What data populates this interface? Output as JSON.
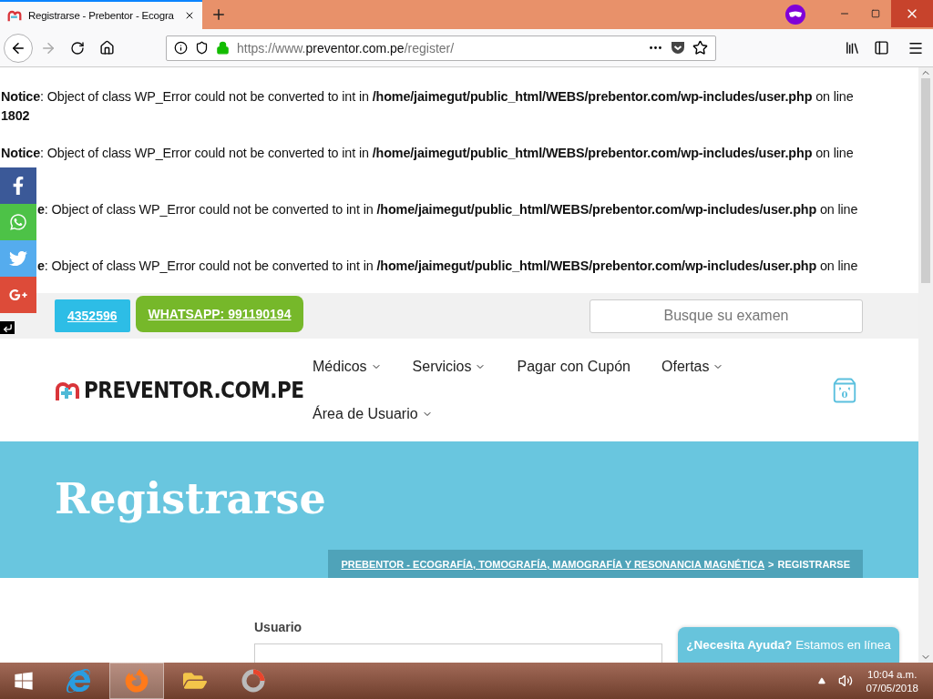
{
  "browser": {
    "tabs": [
      {
        "title": "Registrarse - Prebentor - Ecogra",
        "selected": true
      }
    ],
    "url": {
      "host": "https://www.preventor.com.pe",
      "path": "/register/"
    }
  },
  "notices": [
    {
      "text": "**Notice**: Object of class WP_Error could not be converted to int in **/home/jaimegut/public_html/WEBS/prebentor.com/wp-includes/user.php** on line",
      "line": "1802"
    },
    {
      "text": "**Notice**: Object of class WP_Error could not be converted to int in **/home/jaimegut/public_html/WEBS/prebentor.com/wp-includes/user.php** on line"
    },
    {
      "kind": "covered",
      "text": "**e**: Object of class WP_Error could not be converted to int in **/home/jaimegut/public_html/WEBS/prebentor.com/wp-includes/user.php** on line"
    },
    {
      "kind": "covered",
      "text": "**e**: Object of class WP_Error could not be converted to int in **/home/jaimegut/public_html/WEBS/prebentor.com/wp-includes/user.php** on line"
    }
  ],
  "social": [
    {
      "kind": "facebook",
      "color": "#3b5998"
    },
    {
      "kind": "whatsapp",
      "color": "#4dc247"
    },
    {
      "kind": "twitter",
      "color": "#55acee"
    },
    {
      "kind": "googleplus",
      "color": "#dd4b39"
    }
  ],
  "contact_buttons": [
    {
      "label": "4352596",
      "color": "#2dbde6"
    },
    {
      "label": "WHATSAPP: 991190194",
      "color": "#76b82a"
    }
  ],
  "search": {
    "placeholder": "Busque su examen"
  },
  "logo": {
    "text": "PREVENTOR.COM.PE"
  },
  "nav": [
    {
      "label": "Médicos",
      "dropdown": true
    },
    {
      "label": "Servicios",
      "dropdown": true
    },
    {
      "label": "Pagar con Cupón",
      "dropdown": false
    },
    {
      "label": "Ofertas",
      "dropdown": true
    },
    {
      "label": "Área de Usuario",
      "dropdown": true
    }
  ],
  "cart": {
    "count": "0"
  },
  "hero": {
    "title": "Registrarse",
    "breadcrumb": {
      "link": "PREBENTOR - ECOGRAFÍA, TOMOGRAFÍA, MAMOGRAFÍA Y RESONANCIA MAGNÉTICA",
      "separator": ">",
      "current": "REGISTRARSE"
    }
  },
  "form": {
    "fields": [
      {
        "label": "Usuario"
      }
    ]
  },
  "chat": {
    "question": "¿Necesita Ayuda?",
    "status": "Estamos en línea"
  },
  "taskbar": {
    "apps": [
      {
        "kind": "ie",
        "selected": false
      },
      {
        "kind": "firefox",
        "selected": true
      },
      {
        "kind": "folder",
        "selected": false
      },
      {
        "kind": "recorder",
        "selected": false
      }
    ],
    "time": "10:04 a.m.",
    "date": "07/05/2018"
  }
}
